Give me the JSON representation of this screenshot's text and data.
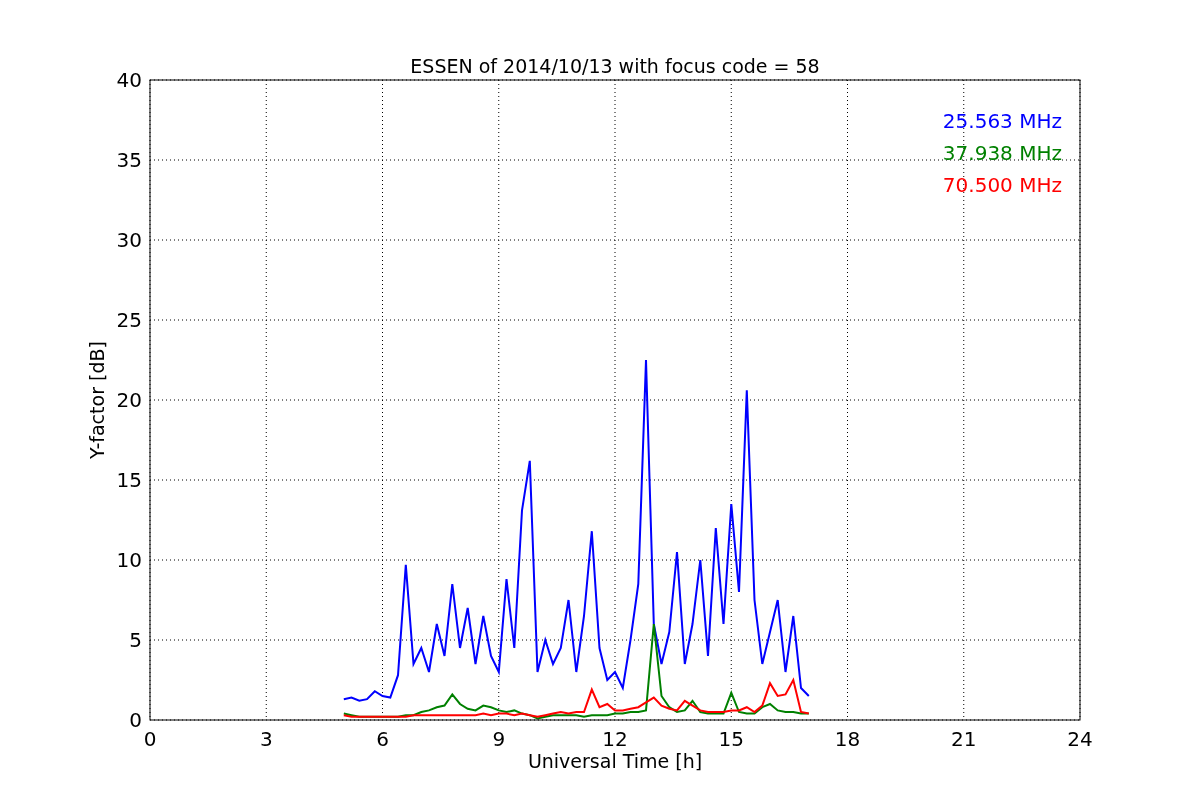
{
  "chart_data": {
    "type": "line",
    "title": "ESSEN of 2014/10/13 with focus code = 58",
    "xlabel": "Universal Time [h]",
    "ylabel": "Y-factor [dB]",
    "x": [
      5.0,
      5.2,
      5.4,
      5.6,
      5.8,
      6.0,
      6.2,
      6.4,
      6.6,
      6.8,
      7.0,
      7.2,
      7.4,
      7.6,
      7.8,
      8.0,
      8.2,
      8.4,
      8.6,
      8.8,
      9.0,
      9.2,
      9.4,
      9.6,
      9.8,
      10.0,
      10.2,
      10.4,
      10.6,
      10.8,
      11.0,
      11.2,
      11.4,
      11.6,
      11.8,
      12.0,
      12.2,
      12.4,
      12.6,
      12.8,
      13.0,
      13.2,
      13.4,
      13.6,
      13.8,
      14.0,
      14.2,
      14.4,
      14.6,
      14.8,
      15.0,
      15.2,
      15.4,
      15.6,
      15.8,
      16.0,
      16.2,
      16.4,
      16.6,
      16.8,
      17.0
    ],
    "series": [
      {
        "name": "25.563 MHz",
        "color": "#0000ff",
        "values": [
          1.3,
          1.4,
          1.2,
          1.3,
          1.8,
          1.5,
          1.4,
          2.8,
          9.7,
          3.5,
          4.5,
          3.0,
          6.0,
          4.0,
          8.5,
          4.5,
          7.0,
          3.5,
          6.5,
          4.0,
          3.0,
          8.8,
          4.5,
          13.1,
          16.2,
          3.0,
          5.0,
          3.5,
          4.5,
          7.5,
          3.0,
          6.5,
          11.8,
          4.5,
          2.5,
          3.0,
          2.0,
          5.0,
          8.5,
          22.5,
          6.0,
          3.5,
          5.5,
          10.5,
          3.5,
          6.0,
          10.0,
          4.0,
          12.0,
          6.0,
          13.5,
          8.0,
          20.6,
          7.5,
          3.5,
          5.5,
          7.5,
          3.0,
          6.5,
          2.0,
          1.5
        ]
      },
      {
        "name": "37.938 MHz",
        "color": "#008000",
        "values": [
          0.4,
          0.3,
          0.2,
          0.2,
          0.2,
          0.2,
          0.2,
          0.2,
          0.3,
          0.3,
          0.5,
          0.6,
          0.8,
          0.9,
          1.6,
          1.0,
          0.7,
          0.6,
          0.9,
          0.8,
          0.6,
          0.5,
          0.6,
          0.4,
          0.3,
          0.1,
          0.2,
          0.3,
          0.3,
          0.3,
          0.3,
          0.2,
          0.3,
          0.3,
          0.3,
          0.4,
          0.4,
          0.5,
          0.5,
          0.6,
          6.0,
          1.5,
          0.8,
          0.5,
          0.6,
          1.2,
          0.5,
          0.4,
          0.4,
          0.4,
          1.7,
          0.5,
          0.4,
          0.4,
          0.8,
          1.0,
          0.6,
          0.5,
          0.5,
          0.4,
          0.4
        ]
      },
      {
        "name": "70.500 MHz",
        "color": "#ff0000",
        "values": [
          0.3,
          0.2,
          0.2,
          0.2,
          0.2,
          0.2,
          0.2,
          0.2,
          0.2,
          0.3,
          0.3,
          0.3,
          0.3,
          0.3,
          0.3,
          0.3,
          0.3,
          0.3,
          0.4,
          0.3,
          0.4,
          0.4,
          0.3,
          0.4,
          0.3,
          0.2,
          0.3,
          0.4,
          0.5,
          0.4,
          0.5,
          0.5,
          1.9,
          0.8,
          1.0,
          0.6,
          0.6,
          0.7,
          0.8,
          1.1,
          1.4,
          0.9,
          0.7,
          0.6,
          1.2,
          0.9,
          0.6,
          0.5,
          0.5,
          0.5,
          0.6,
          0.6,
          0.8,
          0.5,
          0.9,
          2.3,
          1.5,
          1.6,
          2.5,
          0.5,
          0.4
        ]
      }
    ],
    "xlim": [
      0,
      24
    ],
    "ylim": [
      0,
      40
    ],
    "xticks": [
      0,
      3,
      6,
      9,
      12,
      15,
      18,
      21,
      24
    ],
    "yticks": [
      0,
      5,
      10,
      15,
      20,
      25,
      30,
      35,
      40
    ],
    "grid": true
  }
}
